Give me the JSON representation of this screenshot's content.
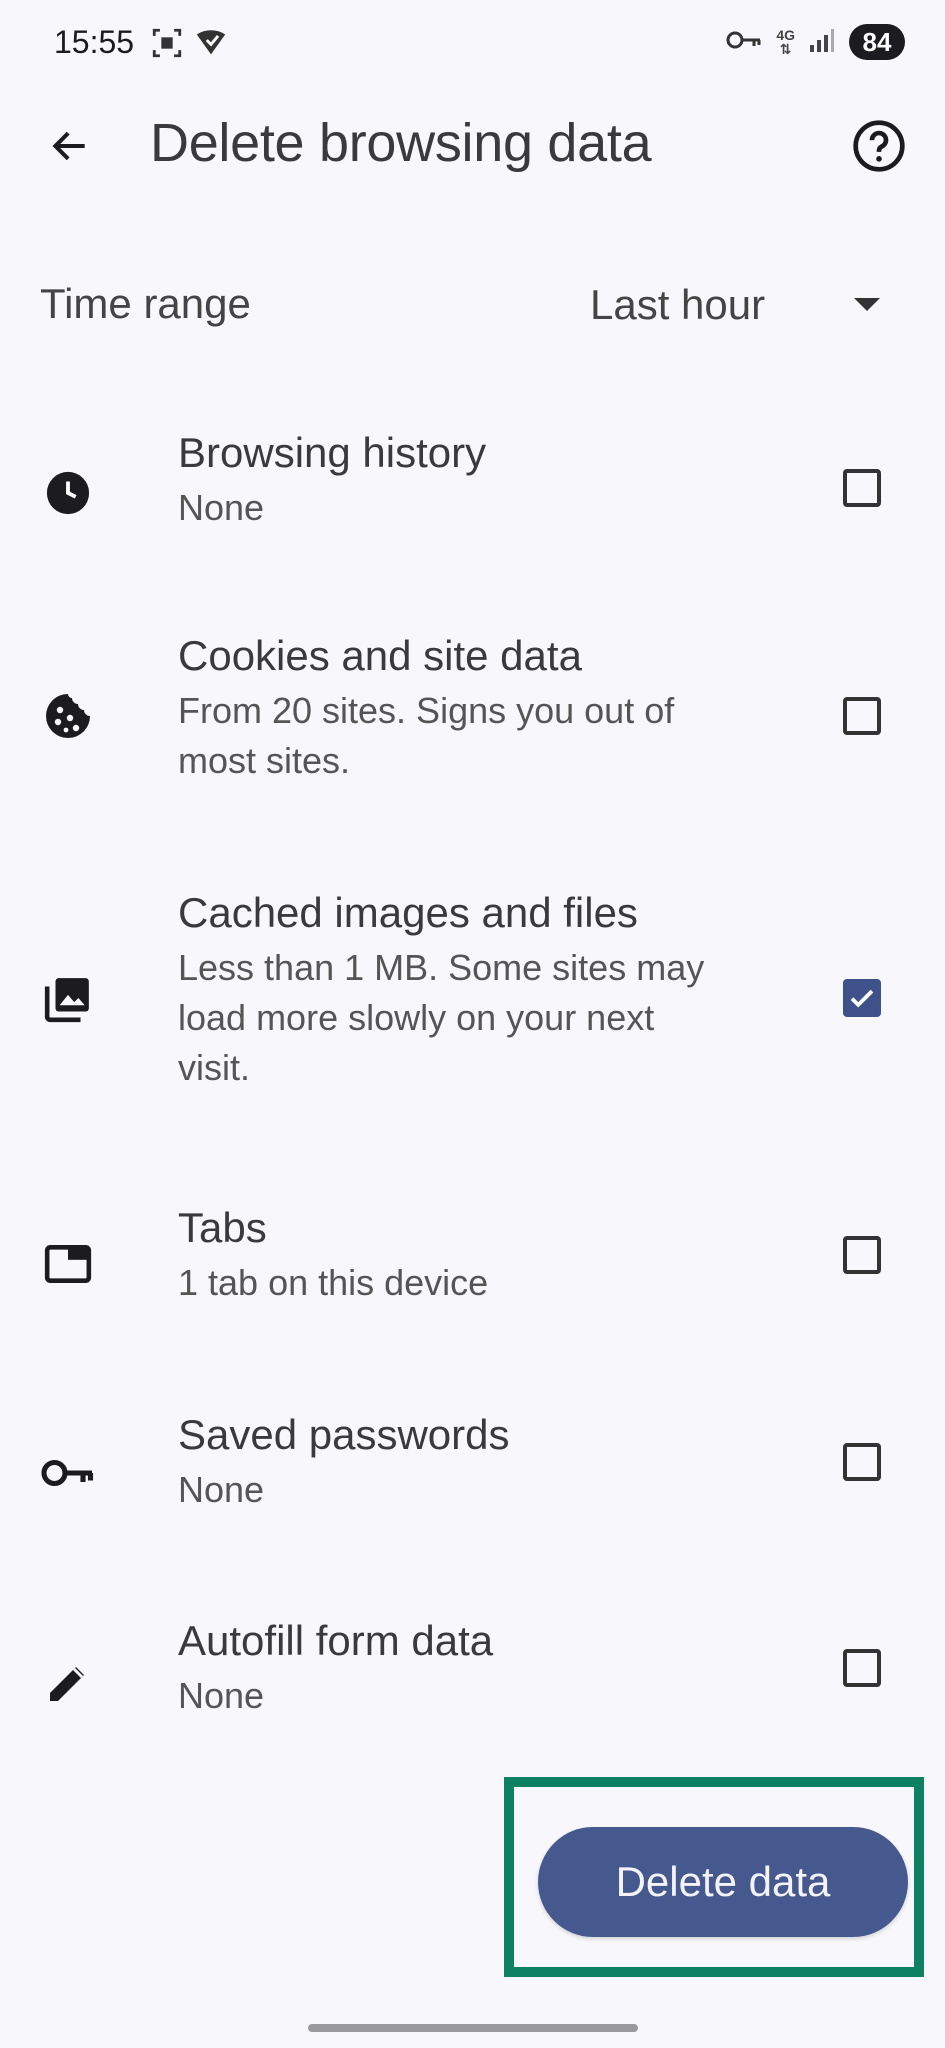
{
  "status": {
    "time": "15:55",
    "network": "4G",
    "battery": "84"
  },
  "header": {
    "title": "Delete browsing data"
  },
  "time_range": {
    "label": "Time range",
    "value": "Last hour"
  },
  "items": [
    {
      "title": "Browsing history",
      "sub": "None",
      "icon": "clock-icon",
      "checked": false
    },
    {
      "title": "Cookies and site data",
      "sub1": "From 20 sites. Signs you out of",
      "sub2": "most sites.",
      "icon": "cookie-icon",
      "checked": false
    },
    {
      "title": "Cached images and files",
      "sub1": "Less than 1 MB. Some sites may",
      "sub2": "load more slowly on your next",
      "sub3": "visit.",
      "icon": "images-icon",
      "checked": true
    },
    {
      "title": "Tabs",
      "sub": "1 tab on this device",
      "icon": "tab-icon",
      "checked": false
    },
    {
      "title": "Saved passwords",
      "sub": "None",
      "icon": "key-icon",
      "checked": false
    },
    {
      "title": "Autofill form data",
      "sub": "None",
      "icon": "pencil-icon",
      "checked": false
    }
  ],
  "actions": {
    "delete_label": "Delete data"
  },
  "colors": {
    "accent": "#3f5189",
    "button": "#46598f",
    "highlight": "#0d8161",
    "background": "#f8f8fc"
  }
}
